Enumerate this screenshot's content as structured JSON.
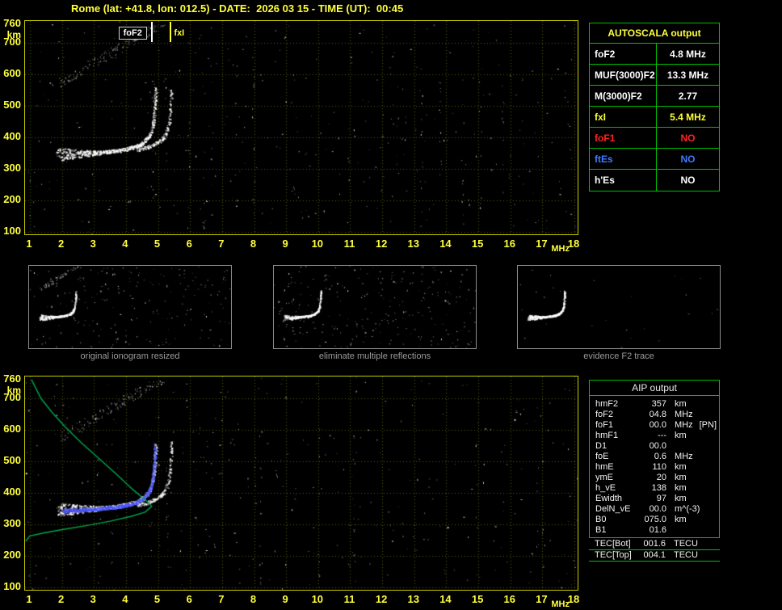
{
  "title": "Rome (lat: +41.8, lon: 012.5) - DATE:  2026 03 15 - TIME (UT):  00:45",
  "autoscala_table": {
    "title": "AUTOSCALA output",
    "border_color": "#00c000",
    "rows": [
      {
        "label": "foF2",
        "value": "4.8 MHz",
        "color": "#ffffff"
      },
      {
        "label": "MUF(3000)F2",
        "value": "13.3 MHz",
        "color": "#ffffff"
      },
      {
        "label": "M(3000)F2",
        "value": "2.77",
        "color": "#ffffff"
      },
      {
        "label": "fxI",
        "value": "5.4 MHz",
        "color": "#ffff30"
      },
      {
        "label": "foF1",
        "value": "NO",
        "color": "#ff2222"
      },
      {
        "label": "ftEs",
        "value": "NO",
        "color": "#3d7bff"
      },
      {
        "label": "h'Es",
        "value": "NO",
        "color": "#ffffff"
      }
    ]
  },
  "thumbnails": [
    {
      "caption": "original ionogram resized"
    },
    {
      "caption": "eliminate multiple reflections"
    },
    {
      "caption": "evidence F2 trace"
    }
  ],
  "aip_table": {
    "title": "AIP output",
    "rows": [
      {
        "label": "hmF2",
        "value": "357",
        "unit": "km"
      },
      {
        "label": "foF2",
        "value": "04.8",
        "unit": "MHz"
      },
      {
        "label": "foF1",
        "value": "00.0",
        "unit": "MHz",
        "note": "[PN]"
      },
      {
        "label": "hmF1",
        "value": "---",
        "unit": "km"
      },
      {
        "label": "D1",
        "value": "00.0",
        "unit": ""
      },
      {
        "label": "foE",
        "value": "0.6",
        "unit": "MHz"
      },
      {
        "label": "hmE",
        "value": "110",
        "unit": "km"
      },
      {
        "label": "ymE",
        "value": "20",
        "unit": "km"
      },
      {
        "label": "h_vE",
        "value": "138",
        "unit": "km"
      },
      {
        "label": "Ewidth",
        "value": "97",
        "unit": "km"
      },
      {
        "label": "DelN_vE",
        "value": "00.0",
        "unit": "m^(-3)"
      },
      {
        "label": "B0",
        "value": "075.0",
        "unit": "km"
      },
      {
        "label": "B1",
        "value": "01.6",
        "unit": ""
      }
    ],
    "tec_rows": [
      {
        "label": "TEC[Bot]",
        "value": "001.6",
        "unit": "TECU"
      },
      {
        "label": "TEC[Top]",
        "value": "004.1",
        "unit": "TECU"
      }
    ]
  },
  "chart_data": [
    {
      "id": "scaled_ionogram",
      "type": "scatter",
      "title": "autoscaled ionogram with foF2 / fxI markers",
      "xlabel": "MHz",
      "ylabel": "km",
      "xlim": [
        1,
        18
      ],
      "ylim": [
        100,
        760
      ],
      "x_ticks": [
        1,
        2,
        3,
        4,
        5,
        6,
        7,
        8,
        9,
        10,
        11,
        12,
        13,
        14,
        15,
        16,
        17,
        18
      ],
      "y_ticks": [
        760,
        700,
        600,
        500,
        400,
        300,
        200,
        100
      ],
      "grid": true,
      "markers": [
        {
          "label": "foF2",
          "freq_mhz": 4.8,
          "color": "#ffffff"
        },
        {
          "label": "fxI",
          "freq_mhz": 5.4,
          "color": "#ffff30"
        }
      ],
      "series": [
        {
          "name": "F2 ordinary echo trace",
          "model": "cusp",
          "color": "#ffffff",
          "f_start_mhz": 1.85,
          "fc_mhz": 4.95,
          "base_km": 318,
          "amp_km": 27,
          "h_top_km": 562
        },
        {
          "name": "F2 extraordinary echo trace",
          "model": "cusp",
          "color": "#ffffff",
          "f_start_mhz": 4.35,
          "fc_mhz": 5.45,
          "base_km": 318,
          "amp_km": 27,
          "h_top_km": 565,
          "skip": 0.55
        },
        {
          "name": "second hop echoes",
          "model": "band",
          "f_range_mhz": [
            1.9,
            5.2
          ],
          "h_range_km": [
            575,
            768
          ]
        }
      ],
      "noise_dots": 340
    },
    {
      "id": "profile_ionogram",
      "type": "scatter",
      "title": "ionogram with restored trace and electron density profile",
      "xlabel": "MHz",
      "ylabel": "km",
      "xlim": [
        1,
        18
      ],
      "ylim": [
        100,
        760
      ],
      "x_ticks": [
        1,
        2,
        3,
        4,
        5,
        6,
        7,
        8,
        9,
        10,
        11,
        12,
        13,
        14,
        15,
        16,
        17,
        18
      ],
      "y_ticks": [
        760,
        700,
        600,
        500,
        400,
        300,
        200,
        100
      ],
      "grid": true,
      "series": [
        {
          "name": "F2 ordinary echo trace",
          "model": "cusp",
          "color": "#ffffff",
          "f_start_mhz": 1.85,
          "fc_mhz": 4.95,
          "base_km": 318,
          "amp_km": 27,
          "h_top_km": 562
        },
        {
          "name": "F2 extraordinary echo trace",
          "model": "cusp",
          "color": "#ffffff",
          "f_start_mhz": 4.35,
          "fc_mhz": 5.45,
          "base_km": 318,
          "amp_km": 27,
          "h_top_km": 565,
          "skip": 0.55
        },
        {
          "name": "second hop echoes",
          "model": "band",
          "f_range_mhz": [
            1.9,
            5.2
          ],
          "h_range_km": [
            575,
            768
          ]
        },
        {
          "name": "restored F2 trace",
          "model": "cusp",
          "color": "#4a55ff",
          "f_start_mhz": 2.0,
          "fc_mhz": 4.93,
          "base_km": 316,
          "amp_km": 27,
          "h_top_km": 556,
          "jit_base": 2,
          "fuzzy": false,
          "size": 2,
          "skip": 0.45
        },
        {
          "name": "electron density profile N(h)",
          "model": "polyline",
          "color": "#00b050",
          "points_mhz_km": [
            [
              1.05,
              760
            ],
            [
              1.35,
              700
            ],
            [
              1.7,
              655
            ],
            [
              2.1,
              610
            ],
            [
              2.6,
              560
            ],
            [
              3.15,
              510
            ],
            [
              3.7,
              460
            ],
            [
              4.2,
              412
            ],
            [
              4.55,
              382
            ],
            [
              4.75,
              365
            ],
            [
              4.8,
              357
            ],
            [
              4.6,
              339
            ],
            [
              4.15,
              325
            ],
            [
              3.5,
              310
            ],
            [
              2.75,
              296
            ],
            [
              2.05,
              284
            ],
            [
              1.45,
              273
            ],
            [
              1.0,
              263
            ],
            [
              0.87,
              246
            ]
          ]
        }
      ],
      "noise_dots": 320
    }
  ]
}
